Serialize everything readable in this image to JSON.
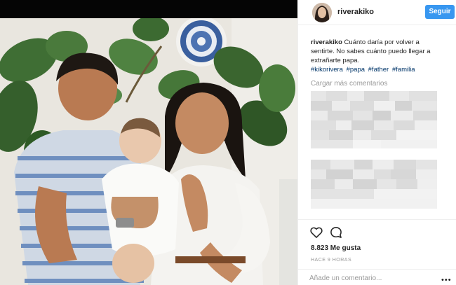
{
  "post": {
    "photo_alt": "Foto de familia"
  },
  "header": {
    "username": "riverakiko",
    "follow_label": "Seguir"
  },
  "caption": {
    "username": "riverakiko",
    "text": " Cuánto daría por volver a sentirte. No sabes cuánto puedo llegar a extrañarte papa.",
    "hashtags": [
      "#kikorivera",
      "#papa",
      "#father",
      "#familia"
    ]
  },
  "comments": {
    "load_more_label": "Cargar más comentarios"
  },
  "actions": {
    "like_icon": "heart-icon",
    "comment_icon": "comment-icon"
  },
  "stats": {
    "likes": "8.823 Me gusta",
    "time_ago": "HACE 9 HORAS"
  },
  "footer": {
    "comment_placeholder": "Añade un comentario...",
    "more_label": "•••"
  },
  "colors": {
    "follow_button": "#3897f0",
    "hashtag": "#003569",
    "muted": "#999999"
  }
}
